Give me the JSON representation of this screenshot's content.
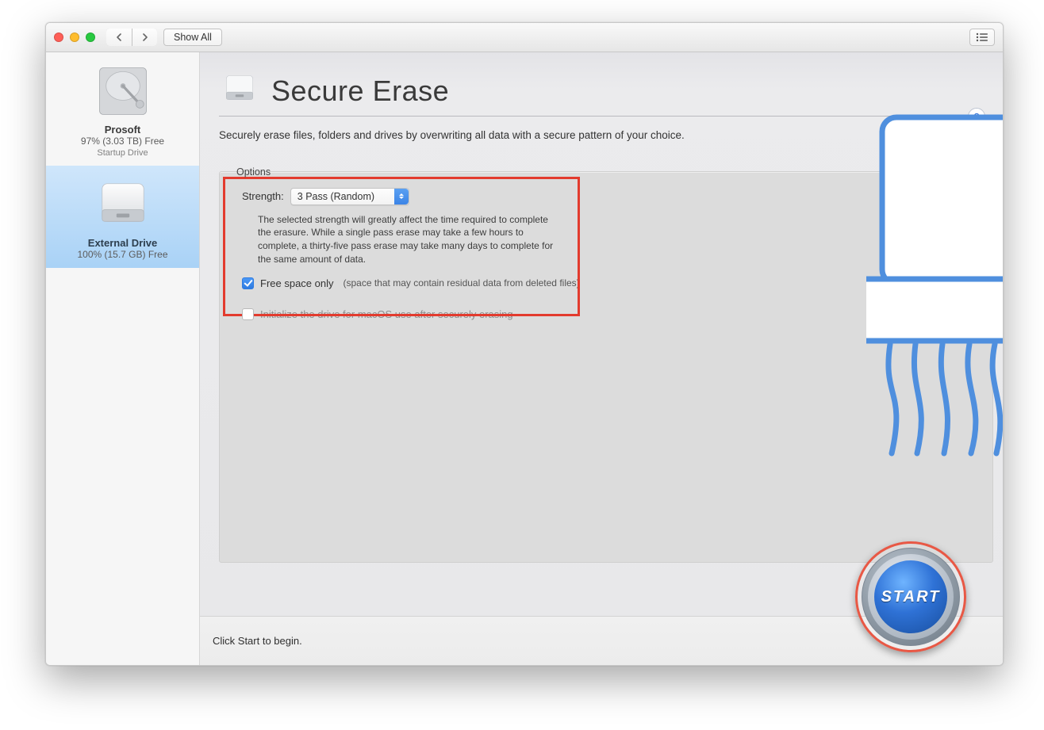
{
  "toolbar": {
    "show_all": "Show All"
  },
  "sidebar": {
    "drives": [
      {
        "name": "Prosoft",
        "free": "97% (3.03 TB) Free",
        "sub": "Startup Drive",
        "selected": false,
        "kind": "internal"
      },
      {
        "name": "External Drive",
        "free": "100% (15.7 GB) Free",
        "sub": "",
        "selected": true,
        "kind": "external"
      }
    ]
  },
  "page": {
    "title": "Secure Erase",
    "description": "Securely erase files, folders and drives by overwriting all data with a secure pattern of your choice.",
    "help": "?"
  },
  "options": {
    "legend": "Options",
    "strength_label": "Strength:",
    "strength_value": "3 Pass (Random)",
    "strength_note": "The selected strength will greatly affect the time required to complete the erasure. While a single pass erase may take a few hours to complete, a thirty-five pass erase may take many days to complete for the same amount of data.",
    "free_space_label": "Free space only",
    "free_space_hint": "(space that may contain residual data from deleted files)",
    "free_space_checked": true,
    "initialize_label": "Initialize the drive for macOS use after securely erasing",
    "initialize_checked": false
  },
  "footer": {
    "hint": "Click Start to begin."
  },
  "start": {
    "label": "START"
  }
}
